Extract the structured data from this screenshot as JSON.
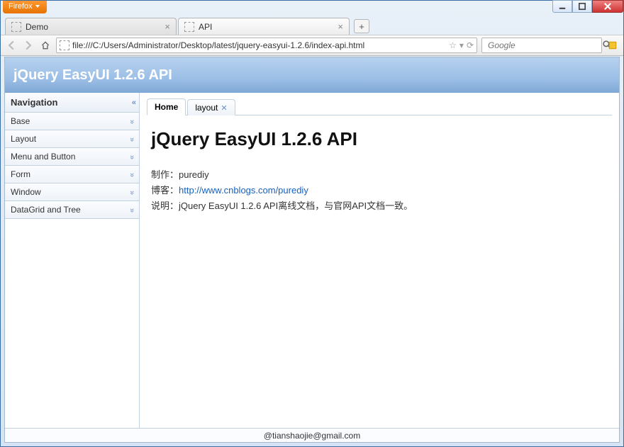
{
  "window": {
    "firefox_label": "Firefox"
  },
  "browser_tabs": [
    {
      "title": "Demo",
      "active": false
    },
    {
      "title": "API",
      "active": true
    }
  ],
  "address_bar": {
    "url": "file:///C:/Users/Administrator/Desktop/latest/jquery-easyui-1.2.6/index-api.html"
  },
  "search_box": {
    "placeholder": "Google"
  },
  "page_header": {
    "title": "jQuery EasyUI 1.2.6 API"
  },
  "sidebar": {
    "title": "Navigation",
    "items": [
      {
        "label": "Base"
      },
      {
        "label": "Layout"
      },
      {
        "label": "Menu and Button"
      },
      {
        "label": "Form"
      },
      {
        "label": "Window"
      },
      {
        "label": "DataGrid and Tree"
      }
    ]
  },
  "content_tabs": [
    {
      "label": "Home",
      "active": true,
      "closable": false
    },
    {
      "label": "layout",
      "active": false,
      "closable": true
    }
  ],
  "content": {
    "heading": "jQuery EasyUI 1.2.6 API",
    "line1_label": "制作：",
    "line1_value": "purediy",
    "line2_label": "博客：",
    "line2_link_text": "http://www.cnblogs.com/purediy",
    "line3_label": "说明：",
    "line3_value": "jQuery EasyUI 1.2.6 API离线文档，与官网API文档一致。"
  },
  "footer": {
    "text": "@tianshaojie@gmail.com"
  }
}
